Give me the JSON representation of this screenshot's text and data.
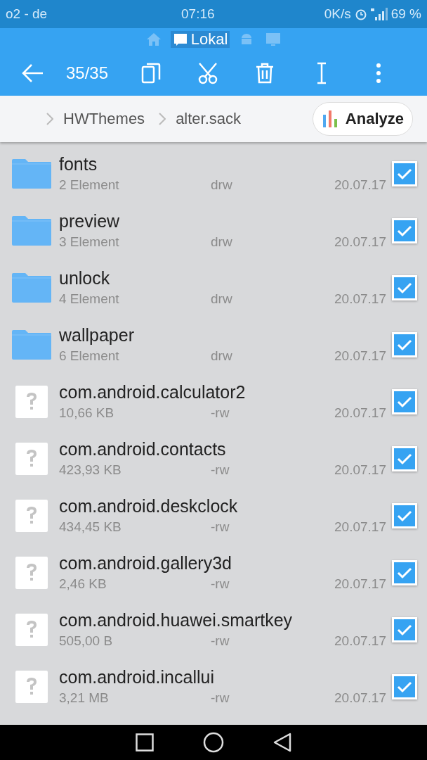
{
  "status_bar": {
    "carrier": "o2 - de",
    "time": "07:16",
    "speed": "0K/s",
    "battery": "69 %"
  },
  "location_tabs": [
    {
      "kind": "home",
      "selected": false
    },
    {
      "kind": "sd",
      "label": "Lokal",
      "selected": true
    },
    {
      "kind": "android",
      "selected": false
    },
    {
      "kind": "remote",
      "selected": false
    }
  ],
  "toolbar": {
    "count": "35/35"
  },
  "breadcrumb": [
    "HWThemes",
    "alter.sack"
  ],
  "analyze_button": "Analyze",
  "files": [
    {
      "kind": "folder",
      "name": "fonts",
      "info": "2 Element",
      "permissions": "drw",
      "date": "20.07.17",
      "checked": true
    },
    {
      "kind": "folder",
      "name": "preview",
      "info": "3 Element",
      "permissions": "drw",
      "date": "20.07.17",
      "checked": true
    },
    {
      "kind": "folder",
      "name": "unlock",
      "info": "4 Element",
      "permissions": "drw",
      "date": "20.07.17",
      "checked": true
    },
    {
      "kind": "folder",
      "name": "wallpaper",
      "info": "6 Element",
      "permissions": "drw",
      "date": "20.07.17",
      "checked": true
    },
    {
      "kind": "file",
      "name": "com.android.calculator2",
      "info": "10,66 KB",
      "permissions": "-rw",
      "date": "20.07.17",
      "checked": true
    },
    {
      "kind": "file",
      "name": "com.android.contacts",
      "info": "423,93 KB",
      "permissions": "-rw",
      "date": "20.07.17",
      "checked": true
    },
    {
      "kind": "file",
      "name": "com.android.deskclock",
      "info": "434,45 KB",
      "permissions": "-rw",
      "date": "20.07.17",
      "checked": true
    },
    {
      "kind": "file",
      "name": "com.android.gallery3d",
      "info": "2,46 KB",
      "permissions": "-rw",
      "date": "20.07.17",
      "checked": true
    },
    {
      "kind": "file",
      "name": "com.android.huawei.smartkey",
      "info": "505,00 B",
      "permissions": "-rw",
      "date": "20.07.17",
      "checked": true
    },
    {
      "kind": "file",
      "name": "com.android.incallui",
      "info": "3,21 MB",
      "permissions": "-rw",
      "date": "20.07.17",
      "checked": true
    }
  ]
}
